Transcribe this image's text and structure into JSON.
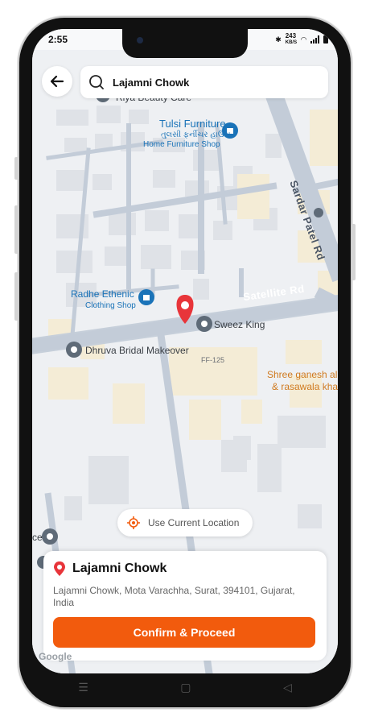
{
  "status_bar": {
    "time": "2:55",
    "net_speed": "243",
    "net_unit": "KB/S"
  },
  "search": {
    "value": "Lajamni Chowk",
    "placeholder": ""
  },
  "map": {
    "labels": {
      "riya": "Riya Beauty Care",
      "tulsi_en": "Tulsi Furniture",
      "tulsi_gu": "તુલસી ફર્નીચર હાઉસ",
      "tulsi_sub": "Home Furniture Shop",
      "sardar": "Sardar Patel Rd",
      "radhe": "Radhe Ethenic",
      "radhe_sub": "Clothing Shop",
      "satellite": "Satellite Rd",
      "sweez": "Sweez King",
      "dhruva": "Dhruva Bridal Makeover",
      "ff125": "FF-125",
      "shree1": "Shree ganesh al",
      "shree2": "& rasawala kha",
      "ce": "ce",
      "google": "Google"
    }
  },
  "use_current_location": "Use Current Location",
  "sheet": {
    "title": "Lajamni Chowk",
    "address": "Lajamni Chowk, Mota Varachha, Surat, 394101, Gujarat, India",
    "confirm_label": "Confirm & Proceed"
  },
  "colors": {
    "accent": "#f25b0d",
    "pin": "#e8353a",
    "poi_blue": "#1a73b8"
  },
  "nav": {
    "menu": "☰",
    "home": "▢",
    "back": "◁"
  }
}
